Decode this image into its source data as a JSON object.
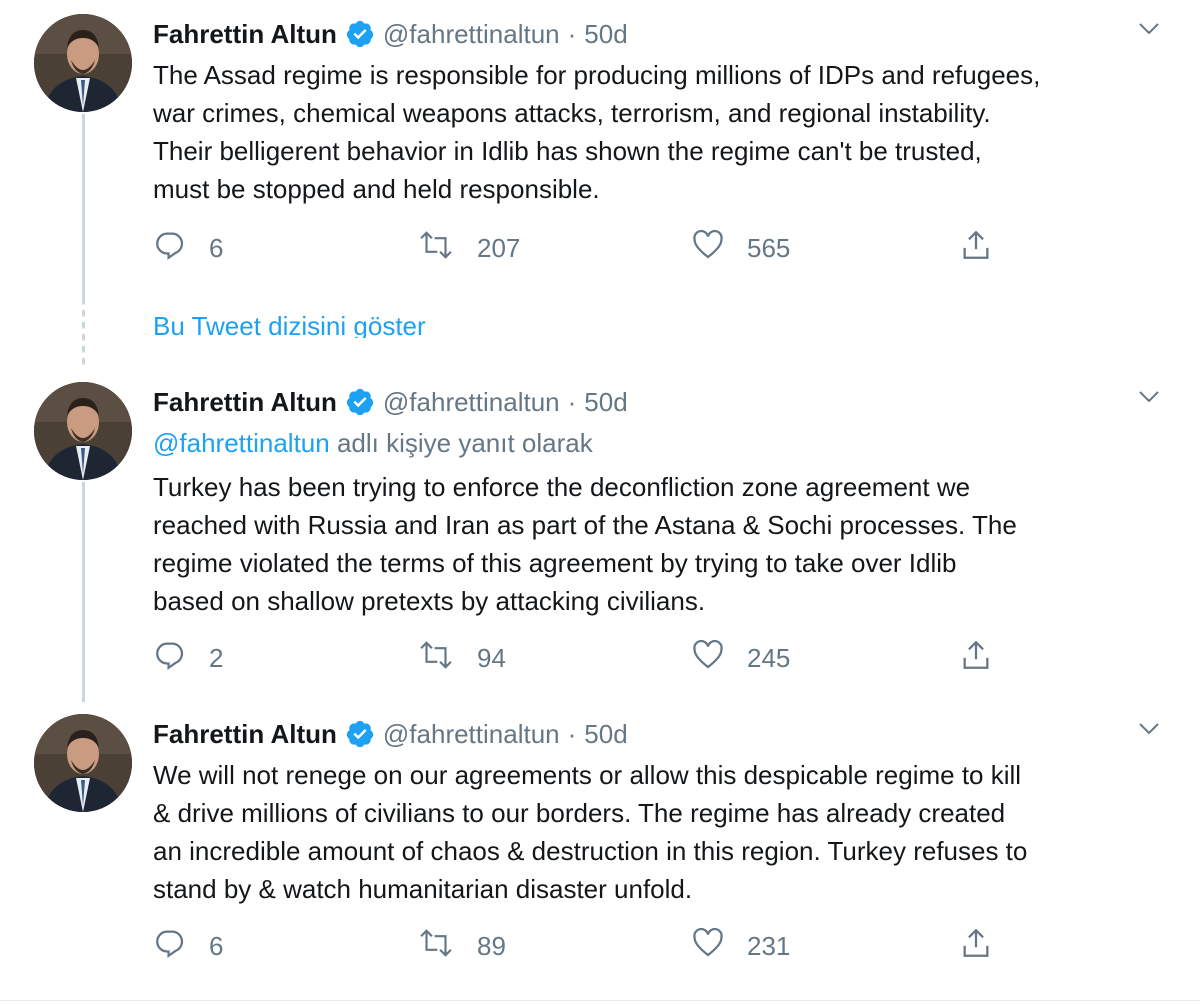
{
  "user": {
    "name": "Fahrettin Altun",
    "handle": "@fahrettinaltun",
    "separator": "·"
  },
  "show_thread_label": "Bu Tweet dizisini göster",
  "tweets": [
    {
      "time": "50d",
      "text": "The Assad regime is responsible for producing millions of IDPs and refugees,\nwar crimes, chemical weapons attacks, terrorism, and regional instability.\nTheir belligerent behavior in Idlib has shown the regime can't be trusted,\nmust be stopped and held responsible.",
      "replies": "6",
      "retweets": "207",
      "likes": "565"
    },
    {
      "time": "50d",
      "reply_to_mention": "@fahrettinaltun",
      "reply_to_suffix": " adlı kişiye yanıt olarak",
      "text": "Turkey has been trying to enforce the deconfliction zone agreement we\nreached with Russia and Iran as part of the Astana & Sochi processes. The\nregime violated the terms of this agreement by trying to take over Idlib\nbased on shallow pretexts by attacking civilians.",
      "replies": "2",
      "retweets": "94",
      "likes": "245"
    },
    {
      "time": "50d",
      "text": "We will not renege on our agreements or allow this despicable regime to kill\n& drive millions of civilians to our borders. The regime has already created\nan incredible amount of chaos & destruction in this region. Turkey refuses to\nstand by & watch humanitarian disaster unfold.",
      "replies": "6",
      "retweets": "89",
      "likes": "231"
    }
  ],
  "icons": {
    "verified": "verified-badge-icon",
    "caret": "chevron-down-icon",
    "reply": "reply-icon",
    "retweet": "retweet-icon",
    "like": "heart-icon",
    "share": "share-icon"
  },
  "colors": {
    "link": "#1da1f2",
    "secondary_text": "#657786",
    "primary_text": "#14171a",
    "thread_line": "#ccd6dd"
  }
}
